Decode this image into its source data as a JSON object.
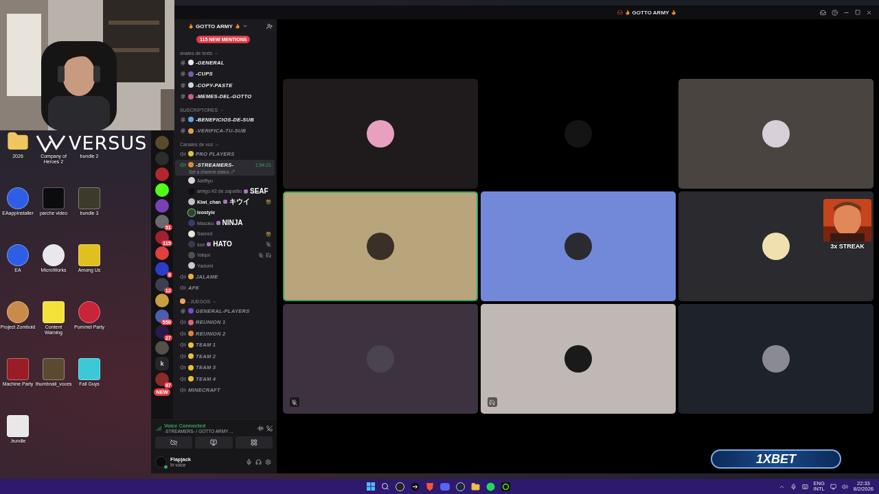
{
  "overlays": {
    "logo": "VERSUS",
    "streak": "3x STREAK",
    "sponsor": "1XBET"
  },
  "desktop_icons": [
    {
      "label": "2026",
      "kind": "folder",
      "color": "#f0c75e"
    },
    {
      "label": "Company of Heroes 2"
    },
    {
      "label": "bundle 2"
    },
    {
      "label": "EAappInstaller",
      "kind": "circle",
      "color": "#2f5ee6"
    },
    {
      "label": "parche video",
      "kind": "square",
      "color": "#0c0c0e"
    },
    {
      "label": "bundle 3",
      "kind": "square",
      "color": "#3c3a2a"
    },
    {
      "label": "EA",
      "kind": "circle",
      "color": "#2f5ee6"
    },
    {
      "label": "MicroWorks",
      "kind": "circle",
      "color": "#e8e8ec"
    },
    {
      "label": "Among Us",
      "kind": "square",
      "color": "#e0c020"
    },
    {
      "label": "Project Zomboid",
      "kind": "circle",
      "color": "#c98a4a"
    },
    {
      "label": "Content Warning",
      "kind": "square",
      "color": "#f2e23a"
    },
    {
      "label": "Pummel Party",
      "kind": "circle",
      "color": "#c8243a"
    },
    {
      "label": "Machine Party",
      "kind": "square",
      "color": "#9a1c24"
    },
    {
      "label": "thumbnail_voces",
      "kind": "square",
      "color": "#5a4a30"
    },
    {
      "label": "Fall Guys",
      "kind": "square",
      "color": "#3cc8d8"
    },
    {
      "label": ".bundle",
      "kind": "square",
      "color": "#e8e8e8"
    }
  ],
  "window": {
    "title": "GOTTO ARMY"
  },
  "server": {
    "name": "GOTTO ARMY",
    "mentions": "115 NEW MENTIONS"
  },
  "servers": [
    {
      "kind": "icon",
      "color": "#5a4a2a"
    },
    {
      "kind": "icon",
      "color": "#2c2c2c"
    },
    {
      "kind": "icon",
      "color": "#b3262d"
    },
    {
      "kind": "icon",
      "color": "#53fc18"
    },
    {
      "kind": "icon",
      "color": "#7b3fb5"
    },
    {
      "kind": "icon",
      "color": "#6a6a6a",
      "badge": "51"
    },
    {
      "kind": "icon",
      "color": "#a02030",
      "badge": "115"
    },
    {
      "kind": "icon",
      "color": "#e04040"
    },
    {
      "kind": "icon",
      "color": "#2b3ec9",
      "badge": "8"
    },
    {
      "kind": "icon",
      "color": "#3a4050",
      "badge": "12"
    },
    {
      "kind": "icon",
      "color": "#c8a040"
    },
    {
      "kind": "icon",
      "color": "#4a5fb0",
      "badge": "550"
    },
    {
      "kind": "icon",
      "color": "#2a1a4a",
      "badge": "27"
    },
    {
      "kind": "icon",
      "color": "#555048"
    },
    {
      "kind": "letter",
      "text": "k"
    },
    {
      "kind": "icon",
      "color": "#8a2a2a",
      "badge": "87"
    },
    {
      "kind": "new",
      "text": "NEW"
    }
  ],
  "channels": [
    {
      "kind": "category",
      "name": "anales de texto"
    },
    {
      "kind": "text",
      "name": "-GENERAL",
      "color": "#e8e8e8",
      "selected": false,
      "unread": true
    },
    {
      "kind": "text",
      "name": "-CUPS",
      "color": "#7a5ab0",
      "selected": false,
      "unread": true
    },
    {
      "kind": "text",
      "name": "-COPY-PASTE",
      "color": "#d0d0e0",
      "selected": false,
      "unread": true
    },
    {
      "kind": "text",
      "name": "-MEMES-DEL-GOTTO",
      "color": "#d05a8a",
      "selected": false,
      "unread": true
    },
    {
      "kind": "category",
      "name": "SUSCRIPTORES"
    },
    {
      "kind": "text",
      "name": "-BENEFICIOS-DE-SUB",
      "color": "#6aa0e0",
      "selected": false,
      "unread": true
    },
    {
      "kind": "text",
      "name": "-VERIFICA-TU-SUB",
      "color": "#e0a040",
      "selected": false,
      "unread": false
    },
    {
      "kind": "category",
      "name": "Canales de voz"
    },
    {
      "kind": "voice",
      "name": "PRO PLAYERS",
      "color": "#e0c040",
      "selected": false,
      "unread": false
    },
    {
      "kind": "voice",
      "name": "-STREAMERS-",
      "color": "#e08a30",
      "selected": true,
      "unread": true,
      "time": "1:54:21",
      "status": "Set a channel status",
      "participants": [
        {
          "name": "Aleffiyu",
          "color": "#e0d0e0",
          "bold": false,
          "speaking": false,
          "activity": false,
          "muted": false,
          "deafened": false
        },
        {
          "name": "amigo #2 de zapatito",
          "tag": "SEAF",
          "color": "#101010",
          "bold": false,
          "speaking": false,
          "activity": false,
          "muted": false,
          "deafened": false
        },
        {
          "name": "Kiwi_chan",
          "tag": "キウイ",
          "color": "#c0c0c0",
          "bold": true,
          "speaking": false,
          "activity": true,
          "muted": false,
          "deafened": false
        },
        {
          "name": "leostyle",
          "color": "#403a30",
          "bold": true,
          "speaking": true,
          "activity": false,
          "muted": false,
          "deafened": false
        },
        {
          "name": "Masoku",
          "tag": "NINJA",
          "color": "#3a3a6a",
          "bold": false,
          "speaking": false,
          "activity": false,
          "muted": false,
          "deafened": false
        },
        {
          "name": "Sacred",
          "color": "#e8e4d8",
          "bold": false,
          "speaking": false,
          "activity": true,
          "muted": false,
          "deafened": false
        },
        {
          "name": "soe",
          "tag": "HATO",
          "color": "#3a3a4a",
          "bold": false,
          "speaking": false,
          "activity": false,
          "muted": true,
          "deafened": false
        },
        {
          "name": "Valqui",
          "color": "#505050",
          "bold": false,
          "speaking": false,
          "activity": false,
          "muted": true,
          "deafened": true
        },
        {
          "name": "Yadomi",
          "color": "#c8c8d0",
          "bold": false,
          "speaking": false,
          "activity": false,
          "muted": false,
          "deafened": false
        }
      ]
    },
    {
      "kind": "voice",
      "name": "JALAME",
      "color": "#f0b030",
      "selected": false,
      "unread": false
    },
    {
      "kind": "voice",
      "name": "AFK",
      "selected": false,
      "unread": false
    },
    {
      "kind": "category",
      "name": "- JUEGOS",
      "color": "#f0a060"
    },
    {
      "kind": "text",
      "name": "GENERAL-PLAYERS",
      "color": "#7a4ad0",
      "selected": false,
      "unread": false
    },
    {
      "kind": "voice",
      "name": "REUNION 1",
      "color": "#e06080",
      "selected": false,
      "unread": false
    },
    {
      "kind": "voice",
      "name": "REUNION 2",
      "color": "#e08040",
      "selected": false,
      "unread": false
    },
    {
      "kind": "voice",
      "name": "TEAM 1",
      "color": "#f0c030",
      "selected": false,
      "unread": false
    },
    {
      "kind": "voice",
      "name": "TEAM 2",
      "color": "#f0c030",
      "selected": false,
      "unread": false
    },
    {
      "kind": "voice",
      "name": "TEAM 3",
      "color": "#f0c030",
      "selected": false,
      "unread": false
    },
    {
      "kind": "voice",
      "name": "TEAM 4",
      "color": "#f0c030",
      "selected": false,
      "unread": false
    },
    {
      "kind": "voice",
      "name": "MINECRAFT",
      "selected": false,
      "unread": false
    }
  ],
  "voice_panel": {
    "status": "Voice Connected",
    "location": "-STREAMERS- / GOTTO ARMY ..."
  },
  "user": {
    "name": "Flapjack",
    "status": "In voice"
  },
  "tiles": [
    {
      "color": "#1f1b1c",
      "avatar": {
        "color": "#e8a0c0"
      },
      "speaking": false,
      "muted": false,
      "deafened": false
    },
    {
      "color": "#000000",
      "avatar": {
        "color": "#141414"
      },
      "speaking": false,
      "muted": false,
      "deafened": false
    },
    {
      "color": "#4a4440",
      "avatar": {
        "color": "#d8d0d8"
      },
      "speaking": false,
      "muted": false,
      "deafened": false
    },
    {
      "color": "#b9a57c",
      "avatar": {
        "color": "#3a3028"
      },
      "speaking": true,
      "muted": false,
      "deafened": false
    },
    {
      "color": "#7289da",
      "avatar": {
        "color": "#2a2a30"
      },
      "speaking": false,
      "muted": false,
      "deafened": false
    },
    {
      "color": "#2b2b2f",
      "avatar": {
        "color": "#f0e0b0"
      },
      "speaking": false,
      "muted": false,
      "deafened": false
    },
    {
      "color": "#3d3340",
      "avatar": {
        "color": "#4a4450"
      },
      "speaking": false,
      "muted": true,
      "deafened": false
    },
    {
      "color": "#c0b8b4",
      "avatar": {
        "color": "#1a1a1a"
      },
      "speaking": false,
      "muted": false,
      "deafened": true
    },
    {
      "color": "#1e222a",
      "avatar": {
        "color": "#8a8a94"
      },
      "speaking": false,
      "muted": false,
      "deafened": false
    }
  ],
  "taskbar": {
    "language": "ENG",
    "layout": "INTL",
    "time": "22:33",
    "date": "8/2/2026"
  }
}
